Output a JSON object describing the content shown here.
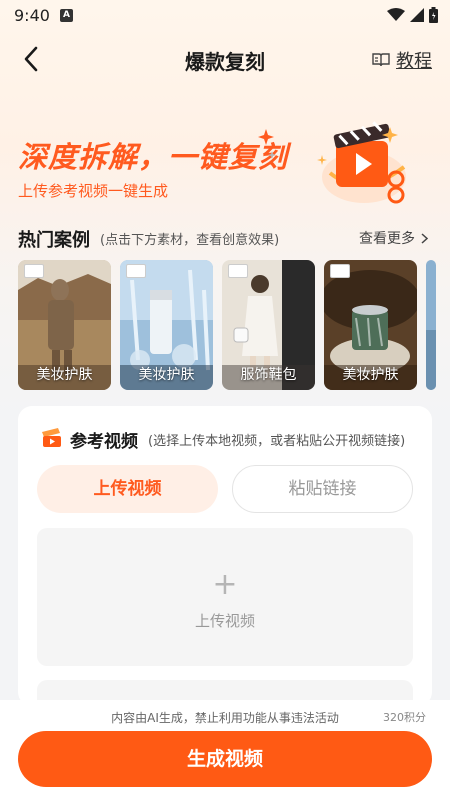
{
  "status_bar": {
    "time": "9:40",
    "notification_letter": "A"
  },
  "header": {
    "title": "爆款复刻",
    "tutorial_label": "教程"
  },
  "banner": {
    "title": "深度拆解，一键复刻",
    "subtitle": "上传参考视频一键生成"
  },
  "hot_cases": {
    "title": "热门案例",
    "hint": "(点击下方素材，查看创意效果)",
    "see_more": "查看更多",
    "items": [
      {
        "label": "美妆护肤"
      },
      {
        "label": "美妆护肤"
      },
      {
        "label": "服饰鞋包"
      },
      {
        "label": "美妆护肤"
      }
    ]
  },
  "reference": {
    "title": "参考视频",
    "hint": "(选择上传本地视频，或者粘贴公开视频链接)",
    "tabs": {
      "upload": "上传视频",
      "paste": "粘贴链接"
    },
    "upload_box": {
      "plus": "+",
      "label": "上传视频"
    }
  },
  "footer": {
    "disclaimer": "内容由AI生成，禁止利用功能从事违法活动",
    "points": "320积分",
    "generate_button": "生成视频"
  },
  "colors": {
    "accent": "#ff5a14",
    "accent_light": "#ffefe6"
  }
}
